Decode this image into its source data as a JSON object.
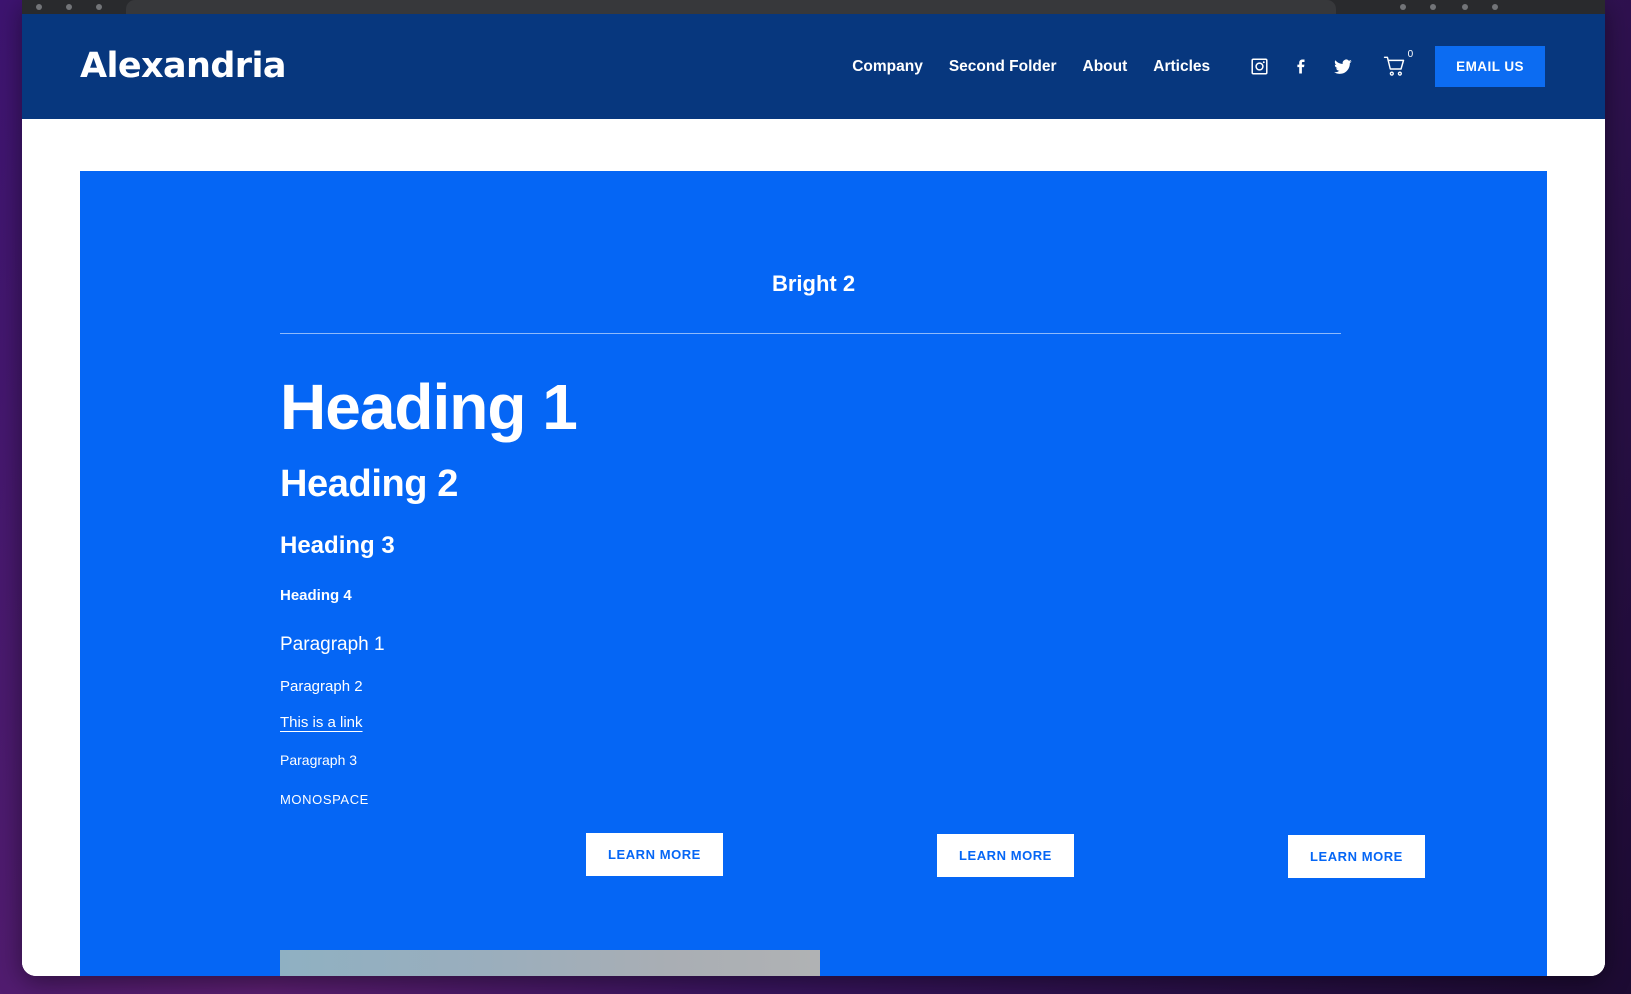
{
  "browser": {
    "chrome_visible": true
  },
  "header": {
    "brand": "Alexandria",
    "nav_links": [
      {
        "label": "Company"
      },
      {
        "label": "Second Folder"
      },
      {
        "label": "About"
      },
      {
        "label": "Articles"
      }
    ],
    "social": [
      {
        "name": "instagram-icon"
      },
      {
        "name": "facebook-icon"
      },
      {
        "name": "twitter-icon"
      }
    ],
    "cart": {
      "icon": "shopping-cart-icon",
      "count": "0"
    },
    "cta": {
      "label": "EMAIL US",
      "color": "#0c6cf2"
    },
    "background_color": "#07377e"
  },
  "content": {
    "panel_title": "Bright 2",
    "panel_background": "#0566f5",
    "heading_1": "Heading 1",
    "heading_2": "Heading 2",
    "heading_3": "Heading 3",
    "heading_4": "Heading 4",
    "paragraph_1": "Paragraph 1",
    "paragraph_2": "Paragraph 2",
    "link_text": "This is a link",
    "paragraph_3": "Paragraph 3",
    "monospace_text": "MONOSPACE",
    "buttons": [
      {
        "label": "LEARN MORE"
      },
      {
        "label": "LEARN MORE"
      },
      {
        "label": "LEARN MORE"
      }
    ]
  }
}
